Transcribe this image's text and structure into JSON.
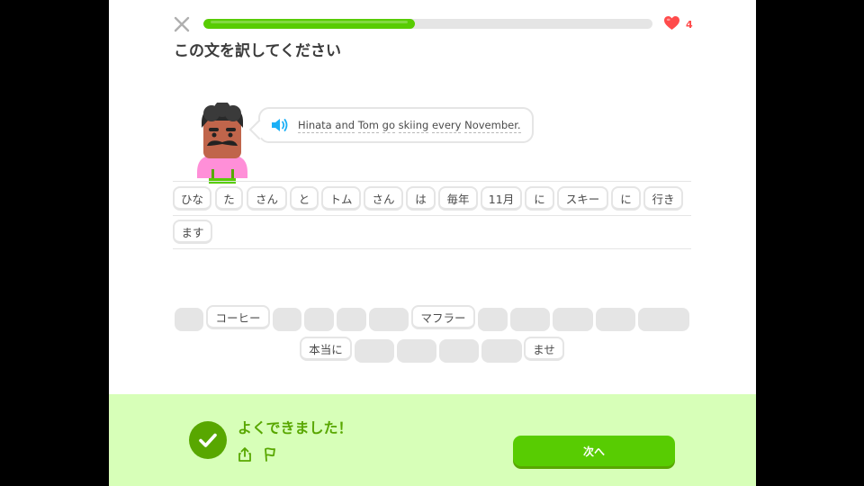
{
  "header": {
    "close_icon": "close-icon",
    "progress_fraction": 0.47,
    "hearts": "4",
    "heart_color": "#ff4b4b"
  },
  "prompt": {
    "title": "この文を訳してください",
    "sentence_words": [
      "Hinata",
      "and",
      "Tom",
      "go",
      "skiing",
      "every",
      "November."
    ]
  },
  "answer_tiles": [
    "ひな",
    "た",
    "さん",
    "と",
    "トム",
    "さん",
    "は",
    "毎年",
    "11月",
    "に",
    "スキー",
    "に",
    "行き",
    "ます"
  ],
  "word_bank": [
    "コーヒー",
    "マフラー",
    "本当に",
    "ませ"
  ],
  "feedback": {
    "title": "よくできました！",
    "next_label": "次へ",
    "accent": "#58cc02",
    "dark_accent": "#58a700",
    "background": "#d7ffb8"
  }
}
